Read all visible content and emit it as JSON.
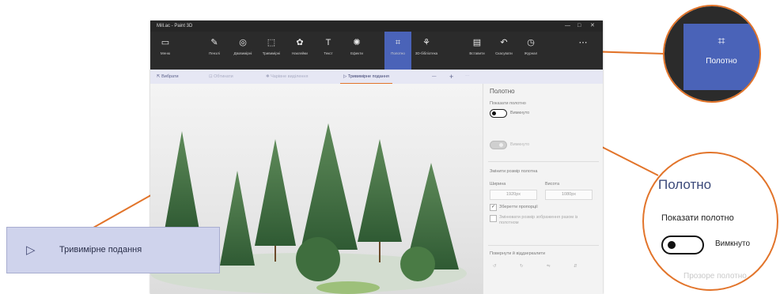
{
  "window": {
    "title": "Mill.ac - Paint 3D"
  },
  "toolbar": {
    "menu": "Меню",
    "tools": [
      {
        "label": "Пензлі",
        "icon": "brush-icon"
      },
      {
        "label": "Двовимірні",
        "icon": "shapes-2d-icon"
      },
      {
        "label": "Тривимірні",
        "icon": "shapes-3d-icon"
      },
      {
        "label": "Наклейки",
        "icon": "stickers-icon"
      },
      {
        "label": "Текст",
        "icon": "text-icon"
      },
      {
        "label": "Ефекти",
        "icon": "effects-icon"
      },
      {
        "label": "Полотно",
        "icon": "canvas-icon",
        "active": true
      },
      {
        "label": "3D-бібліотека",
        "icon": "library-icon"
      },
      {
        "label": "Вставити",
        "icon": "paste-icon"
      },
      {
        "label": "Скасувати",
        "icon": "undo-icon"
      },
      {
        "label": "Журнал",
        "icon": "history-icon"
      }
    ]
  },
  "subbar": {
    "select": "Вибрати",
    "crop": "Обтинати",
    "magic_select": "Чарівне виділення",
    "view3d": "Тривимірне подання"
  },
  "panel": {
    "title": "Полотно",
    "show_canvas_label": "Показати полотно",
    "show_canvas_state": "Вимкнуто",
    "transparent_state": "Вимкнуто",
    "resize_label": "Змінити розмір полотна",
    "width_label": "Ширина",
    "height_label": "Висота",
    "width_value": "1920px",
    "height_value": "1080px",
    "keep_ratio": "Зберегти пропорції",
    "resize_image": "Змінювати розмір зображення разом із полотном",
    "rotate_label": "Повернути й віддзеркалити"
  },
  "callout_3d": {
    "label": "Тривимірне подання"
  },
  "zoom_toolbar": {
    "label": "Полотно"
  },
  "zoom_panel": {
    "title": "Полотно",
    "show_label": "Показати полотно",
    "state": "Вимкнуто",
    "partial": "Прозоре полотно"
  },
  "colors": {
    "accent": "#4a63b8",
    "callout_line": "#e2742a",
    "toolbar_bg": "#2b2b2b"
  }
}
